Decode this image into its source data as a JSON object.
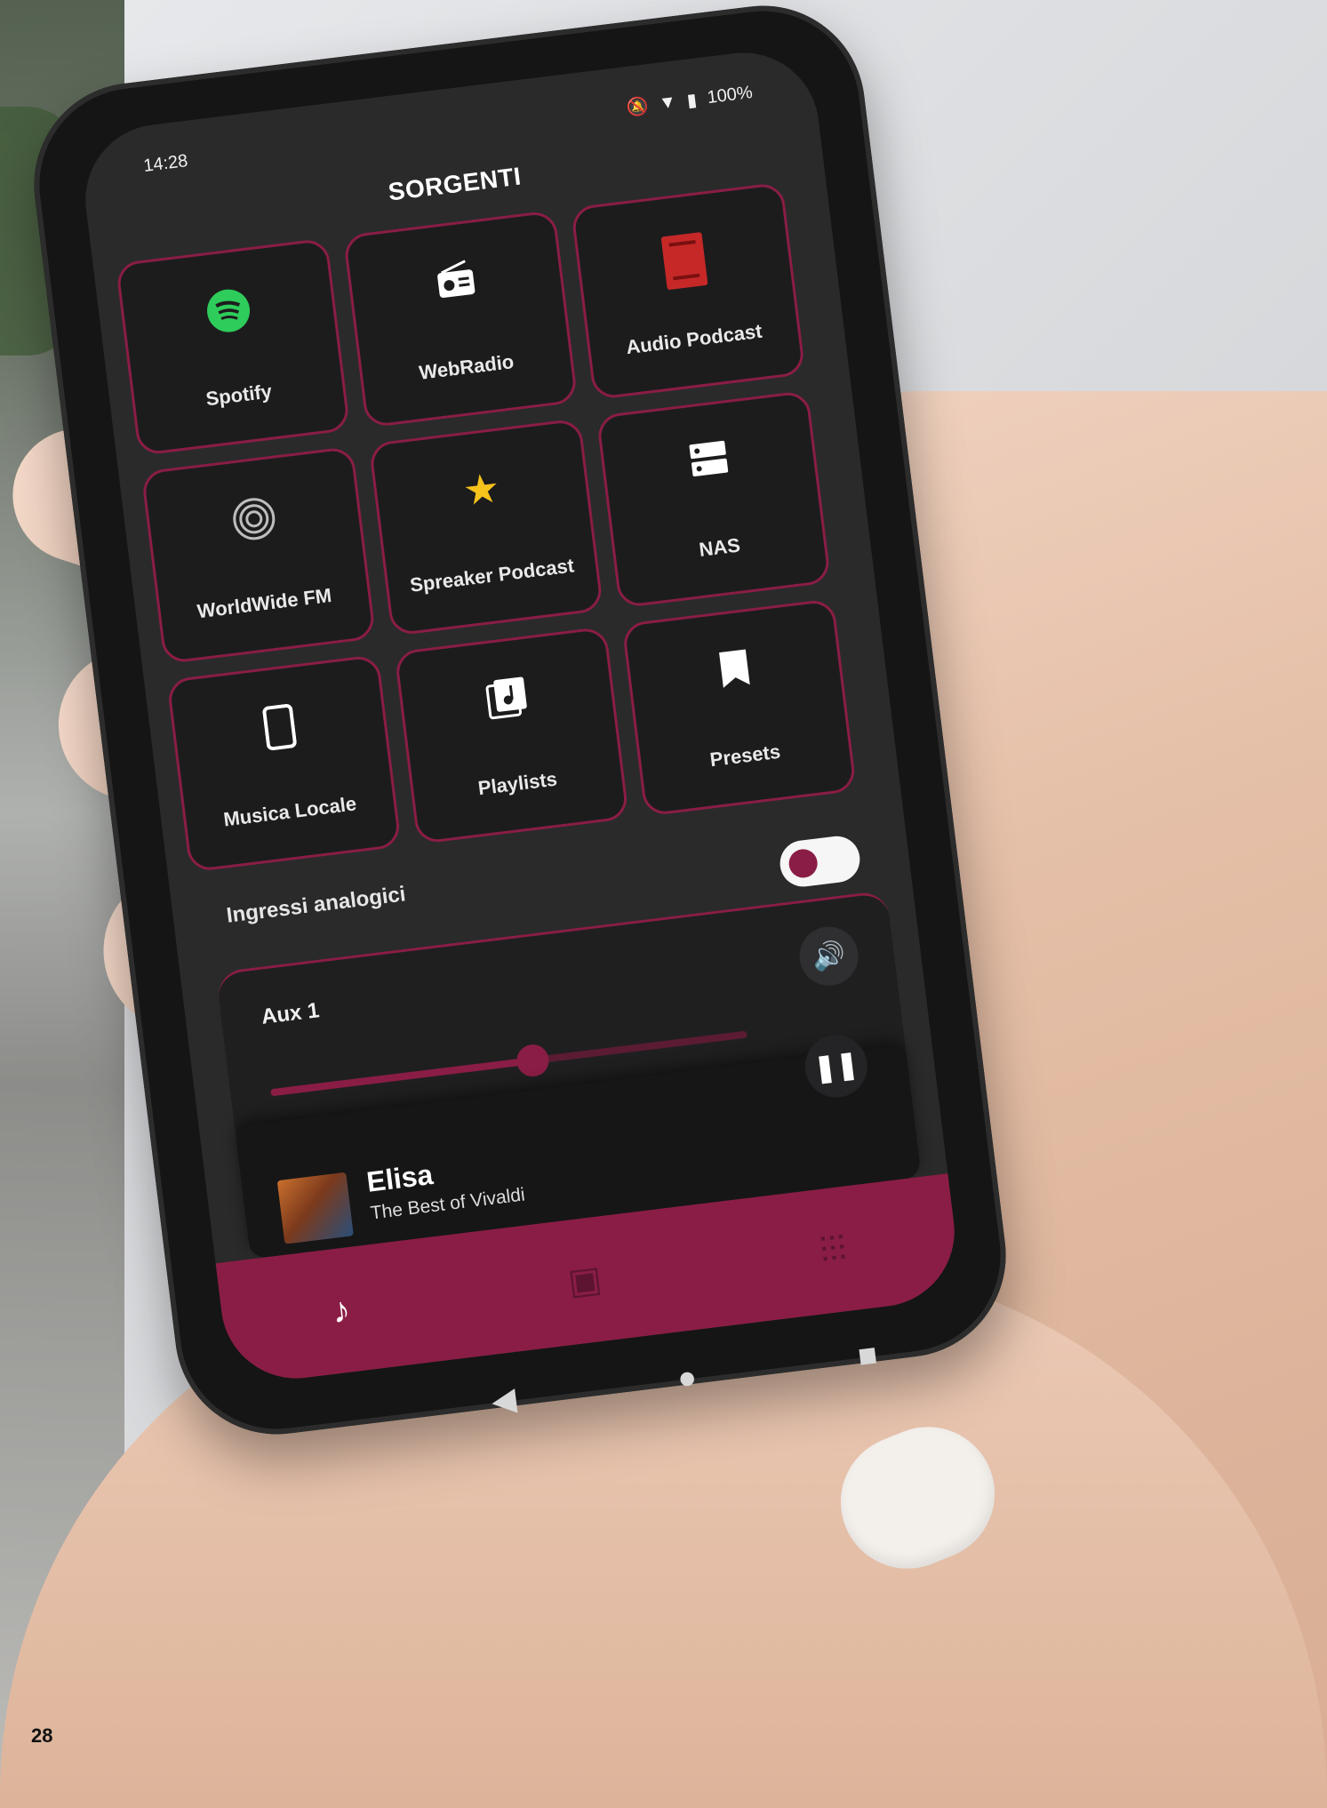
{
  "status_bar": {
    "time": "14:28",
    "battery": "100%"
  },
  "header": {
    "title": "SORGENTI"
  },
  "sources": [
    {
      "label": "Spotify",
      "icon": "spotify-icon",
      "color": "#2ecc5a"
    },
    {
      "label": "WebRadio",
      "icon": "radio-icon",
      "color": "#ffffff"
    },
    {
      "label": "Audio Podcast",
      "icon": "podcast-icon",
      "color": "#c62828"
    },
    {
      "label": "WorldWide FM",
      "icon": "worldwide-fm-icon",
      "color": "#bdbdbd"
    },
    {
      "label": "Spreaker Podcast",
      "icon": "star-icon",
      "color": "#f6c21c"
    },
    {
      "label": "NAS",
      "icon": "nas-icon",
      "color": "#ffffff"
    },
    {
      "label": "Musica Locale",
      "icon": "phone-icon",
      "color": "#ffffff"
    },
    {
      "label": "Playlists",
      "icon": "playlist-icon",
      "color": "#ffffff"
    },
    {
      "label": "Presets",
      "icon": "bookmark-icon",
      "color": "#ffffff"
    }
  ],
  "analog_inputs": {
    "section_label": "Ingressi analogici",
    "toggle_on": true,
    "aux_label": "Aux 1",
    "volume_level": 0.55
  },
  "now_playing": {
    "artist": "Elisa",
    "album": "The Best of Vivaldi",
    "state": "playing"
  },
  "bottom_nav": [
    {
      "icon": "music-note-icon",
      "active": true
    },
    {
      "icon": "speaker-icon",
      "active": false
    },
    {
      "icon": "equalizer-icon",
      "active": false
    }
  ],
  "page_number": "28",
  "colors": {
    "accent": "#8a1d45",
    "background": "#2a2a2b",
    "tile": "#1c1c1d"
  }
}
